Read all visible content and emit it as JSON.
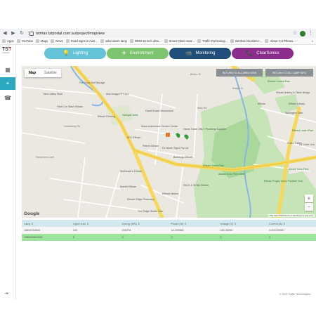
{
  "browser": {
    "url": "tstmax.tstportal.com.au/project/mapview",
    "bookmarks": [
      {
        "label": "Apps"
      },
      {
        "label": "YouTube"
      },
      {
        "label": "Maps"
      },
      {
        "label": "News"
      },
      {
        "label": "Road signs in Aust..."
      },
      {
        "label": "solar alarm lamp"
      },
      {
        "label": "DDW 48 Inch ultra..."
      },
      {
        "label": "Smart Cities Awar..."
      },
      {
        "label": "Traffic Technologi..."
      },
      {
        "label": "Berthold Akzidenz-..."
      },
      {
        "label": "About Cct Phraso..."
      }
    ],
    "bookmarks_more": "»"
  },
  "sidebar": {
    "logo_main_a": "TS",
    "logo_main_b": "T",
    "logo_sub": "TRAFFIC",
    "exit_icon": "⇥"
  },
  "tabs": [
    {
      "label": "Lighting",
      "icon": "💡",
      "color": "#67c4d6"
    },
    {
      "label": "Environment",
      "icon": "✈",
      "color": "#7dc46f"
    },
    {
      "label": "Monitoring",
      "icon": "📹",
      "color": "#1f4f7a"
    },
    {
      "label": "ClearSonics",
      "icon": "📞",
      "color": "#8c2d8e"
    }
  ],
  "map": {
    "map_label": "Map",
    "satellite_label": "Satellite",
    "return_all_area": "RETURN TO ALL AREA VIEW",
    "return_all_lamp": "RETURN TO ALL LAMP INFO",
    "zoom_in": "+",
    "zoom_out": "−",
    "google": "Google",
    "attribution": "Map data ©2019   Terms of Use   Report a map error",
    "pois": [
      {
        "text": "Fort Knox Self Storage",
        "cls": ""
      },
      {
        "text": "Yarra Valley Steel",
        "cls": ""
      },
      {
        "text": "Havit Car Wash Eltham",
        "cls": ""
      },
      {
        "text": "Auto Image PTY Ltd",
        "cls": ""
      },
      {
        "text": "Eltham Fencing",
        "cls": ""
      },
      {
        "text": "Karingal Vallis",
        "cls": "green"
      },
      {
        "text": "David Brown Mechanical",
        "cls": ""
      },
      {
        "text": "Moss Automotive Service Centre",
        "cls": ""
      },
      {
        "text": "KFC Eltham",
        "cls": ""
      },
      {
        "text": "Pellem Eltham",
        "cls": ""
      },
      {
        "text": "De Neefe Signs Pty Ltd",
        "cls": ""
      },
      {
        "text": "Harris Trade ONLY Plumbing Supplies",
        "cls": ""
      },
      {
        "text": "Bunnings Eltham",
        "cls": ""
      },
      {
        "text": "McDonald's Eltham",
        "cls": ""
      },
      {
        "text": "Mobil's Eltham",
        "cls": ""
      },
      {
        "text": "Eltham Motors",
        "cls": ""
      },
      {
        "text": "Eltham Ridge Pharmacy",
        "cls": ""
      },
      {
        "text": "The Ridge Health Club",
        "cls": ""
      },
      {
        "text": "PACK & SEND Eltham",
        "cls": ""
      },
      {
        "text": "Eltham Skate Park",
        "cls": "green"
      },
      {
        "text": "Alistair Knox Park West",
        "cls": "green"
      },
      {
        "text": "Eltham Rugby Union Football Club",
        "cls": "green"
      },
      {
        "text": "Eltham Central Park",
        "cls": "green"
      },
      {
        "text": "Eltham Library",
        "cls": ""
      },
      {
        "text": "Eltham Bakery & Tickle Bridge",
        "cls": ""
      },
      {
        "text": "Wellington Cafe",
        "cls": ""
      },
      {
        "text": "Eltham Lower Park",
        "cls": "green"
      },
      {
        "text": "Alistair Knox Park",
        "cls": "green"
      },
      {
        "text": "Fitzsimons Lane",
        "cls": "road"
      },
      {
        "text": "Main Rd",
        "cls": "road"
      },
      {
        "text": "Heidelberg Rd",
        "cls": "road"
      },
      {
        "text": "La Trobe Univ",
        "cls": ""
      },
      {
        "text": "Public Toilets",
        "cls": ""
      },
      {
        "text": "Bridge St",
        "cls": "road"
      },
      {
        "text": "Bolton St",
        "cls": "road"
      },
      {
        "text": "Eltham",
        "cls": ""
      }
    ]
  },
  "table": {
    "headers": [
      "Lamp ⇕",
      "Light Level ⇕",
      "Energy (Wh) ⇕",
      "Power (W) ⇕",
      "Voltage (V) ⇕",
      "Current (A) ⇕"
    ],
    "rows": [
      [
        "10894764940",
        "100",
        "290378",
        "12.299988",
        "245.36993",
        "0.005769957"
      ],
      [
        "10894/8641206",
        "0",
        "0",
        "0",
        "0",
        "0"
      ]
    ]
  },
  "footer": "© 2019 Traffic Technologies",
  "colors": {
    "accent": "#2aa9c0",
    "row_highlight": "#9be59b",
    "header_bg": "#cfe9ee"
  }
}
